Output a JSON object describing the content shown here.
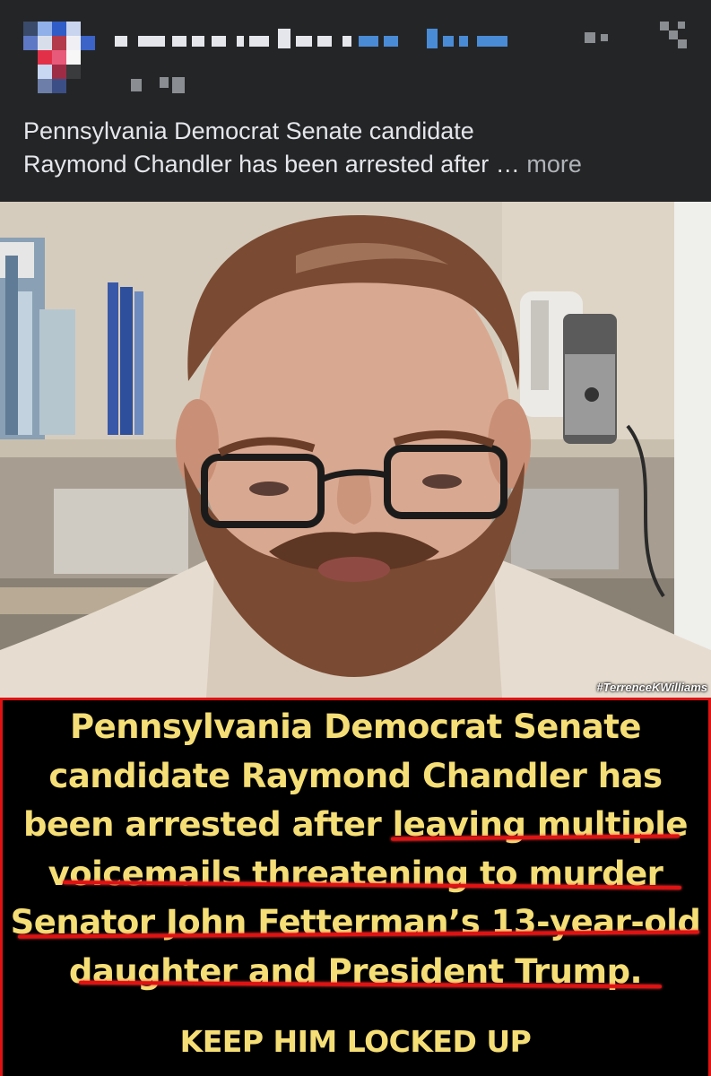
{
  "post": {
    "caption_line1": "Pennsylvania Democrat Senate candidate",
    "caption_line2": "Raymond Chandler has been arrested after …",
    "more_label": "more"
  },
  "photo": {
    "watermark": "#TerrenceKWilliams"
  },
  "banner": {
    "line1": "Pennsylvania Democrat Senate",
    "line2": "candidate Raymond Chandler has",
    "line3": "been arrested after leaving multiple",
    "line4": "voicemails threatening to murder",
    "line5": "Senator John Fetterman’s 13-year-old",
    "line6": "daughter and President Trump.",
    "cta": "KEEP HIM LOCKED UP"
  },
  "colors": {
    "background": "#242526",
    "caption_text": "#e4e6eb",
    "banner_text": "#f5de76",
    "banner_border": "#e01212",
    "underline": "#e01212"
  },
  "icons": [
    "avatar-pixelated",
    "more-options-icon",
    "close-icon"
  ]
}
